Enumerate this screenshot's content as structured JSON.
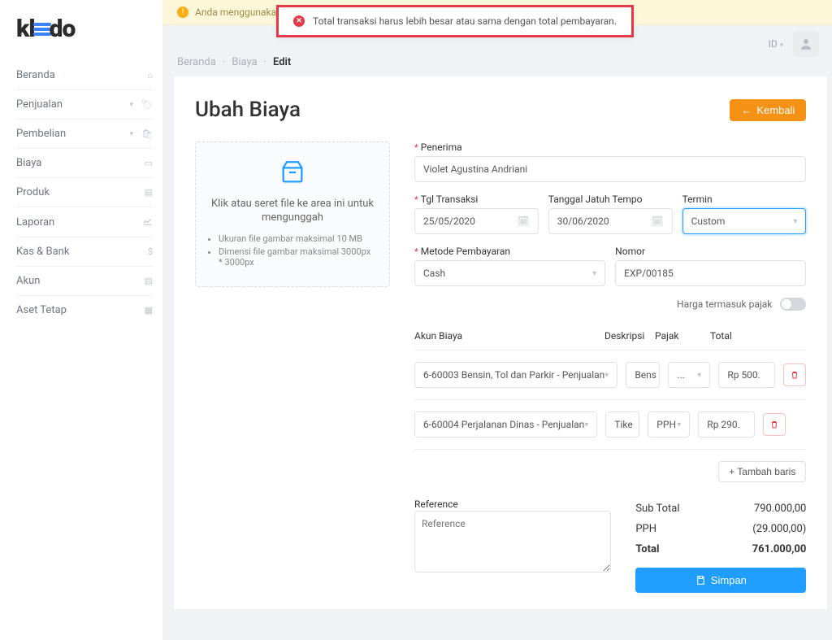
{
  "brand": "kledo",
  "locale": "ID",
  "banner_warning": "Anda menggunakan contoh ... ... Anda",
  "error_message": "Total transaksi harus lebih besar atau sama dengan total pembayaran.",
  "breadcrumb": {
    "home": "Beranda",
    "section": "Biaya",
    "page": "Edit"
  },
  "nav": {
    "items": [
      {
        "label": "Beranda",
        "expandable": false
      },
      {
        "label": "Penjualan",
        "expandable": true
      },
      {
        "label": "Pembelian",
        "expandable": true
      },
      {
        "label": "Biaya",
        "expandable": false
      },
      {
        "label": "Produk",
        "expandable": false
      },
      {
        "label": "Laporan",
        "expandable": false
      },
      {
        "label": "Kas & Bank",
        "expandable": false
      },
      {
        "label": "Akun",
        "expandable": false
      },
      {
        "label": "Aset Tetap",
        "expandable": false
      }
    ]
  },
  "page_title": "Ubah Biaya",
  "back_button": "Kembali",
  "upload": {
    "title": "Klik atau seret file ke area ini untuk mengunggah",
    "hint1": "Ukuran file gambar maksimal 10 MB",
    "hint2": "Dimensi file gambar maksimal 3000px * 3000px"
  },
  "form": {
    "penerima": {
      "label": "Penerima",
      "value": "Violet Agustina Andriani"
    },
    "tgl_transaksi": {
      "label": "Tgl Transaksi",
      "value": "25/05/2020"
    },
    "tgl_jatuh": {
      "label": "Tanggal Jatuh Tempo",
      "value": "30/06/2020"
    },
    "termin": {
      "label": "Termin",
      "value": "Custom"
    },
    "metode": {
      "label": "Metode Pembayaran",
      "value": "Cash"
    },
    "nomor": {
      "label": "Nomor",
      "value": "EXP/00185"
    },
    "tax_toggle": "Harga termasuk pajak"
  },
  "line_header": {
    "akun": "Akun Biaya",
    "desk": "Deskripsi",
    "pajak": "Pajak",
    "total": "Total"
  },
  "lines": [
    {
      "akun": "6-60003 Bensin, Tol dan Parkir - Penjualan",
      "desk": "Bens",
      "pajak": "...",
      "total": "Rp 500."
    },
    {
      "akun": "6-60004 Perjalanan Dinas - Penjualan",
      "desk": "Tike",
      "pajak": "PPH",
      "total": "Rp 290."
    }
  ],
  "add_row": "Tambah baris",
  "reference": {
    "label": "Reference",
    "placeholder": "Reference"
  },
  "totals": {
    "subtotal": {
      "label": "Sub Total",
      "value": "790.000,00"
    },
    "pph": {
      "label": "PPH",
      "value": "(29.000,00)"
    },
    "total": {
      "label": "Total",
      "value": "761.000,00"
    }
  },
  "save": "Simpan"
}
